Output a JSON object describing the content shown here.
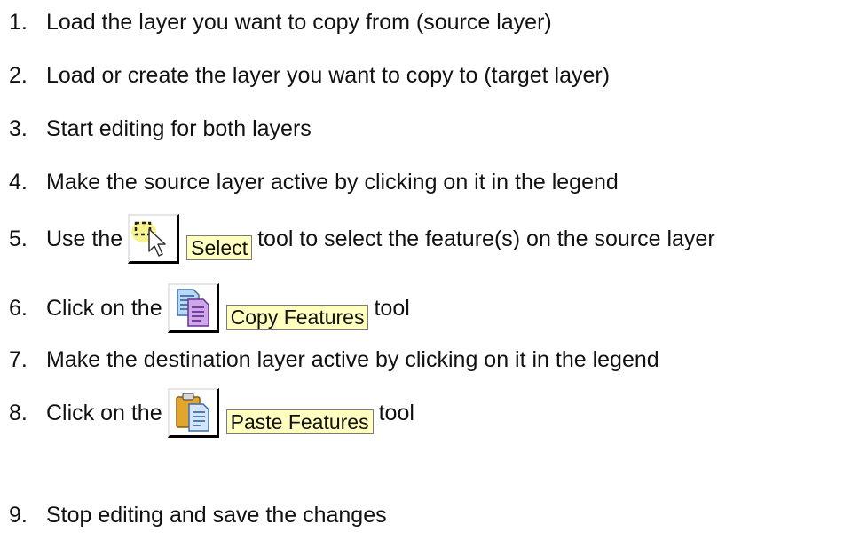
{
  "steps": [
    {
      "num": "1.",
      "text": "Load the layer you want to copy from (source layer)"
    },
    {
      "num": "2.",
      "text": "Load or create the layer you want to copy to (target layer)"
    },
    {
      "num": "3.",
      "text": "Start editing for both layers"
    },
    {
      "num": "4.",
      "text": "Make the source layer active by clicking on it in the legend"
    },
    {
      "num": "5.",
      "before": "Use the",
      "button": "Select",
      "after": "tool to select the feature(s) on the source layer",
      "icon": "select-icon"
    },
    {
      "num": "6.",
      "before": "Click on the",
      "button": "Copy Features",
      "after": "tool",
      "icon": "copy-features-icon"
    },
    {
      "num": "7.",
      "text": "Make the destination layer active by clicking on it in the legend"
    },
    {
      "num": "8.",
      "before": "Click on the",
      "button": "Paste Features",
      "after": "tool",
      "icon": "paste-features-icon"
    },
    {
      "num": "9.",
      "text": "Stop editing and save the changes"
    }
  ],
  "colors": {
    "tooltip_bg": "#ffffc0",
    "text": "#111111"
  }
}
